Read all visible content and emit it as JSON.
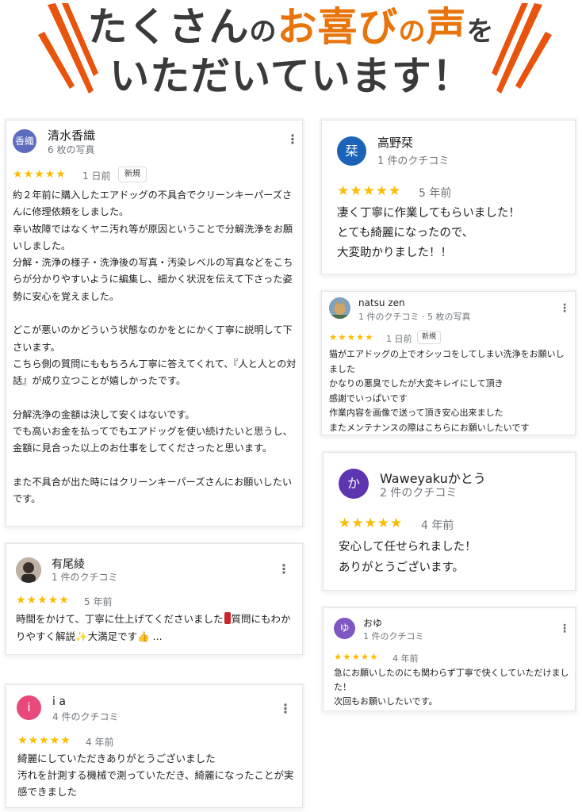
{
  "header": {
    "line1_parts": [
      "たくさん",
      "の",
      "お喜び",
      "の",
      "声",
      "を"
    ],
    "line2": "いただいています！"
  },
  "reviews": [
    {
      "name": "清水香織",
      "avatar_text": "香織",
      "avatar_color": "#5c6bc0",
      "meta": "6 枚の写真",
      "stars": "★★★★★",
      "time": "1 日前",
      "badge": "新規",
      "body": "約２年前に購入したエアドッグの不具合でクリーンキーパーズさんに修理依頼をしました。\n幸い故障ではなくヤニ汚れ等が原因ということで分解洗浄をお願いしました。\n分解・洗浄の様子・洗浄後の写真・汚染レベルの写真などをこちらが分かりやすいように編集し、細かく状況を伝えて下さった姿勢に安心を覚えました。\n\nどこが悪いのかどういう状態なのかをとにかく丁寧に説明して下さいます。\nこちら側の質問にももちろん丁寧に答えてくれて、『人と人との対話』が成り立つことが嬉しかったです。\n\n分解洗浄の金額は決して安くはないです。\nでも高いお金を払ってでもエアドッグを使い続けたいと思うし、金額に見合った以上のお仕事をしてくださったと思います。\n\nまた不具合が出た時にはクリーンキーパーズさんにお願いしたいです。"
    },
    {
      "name": "有尾綾",
      "avatar_text": "",
      "avatar_color": "#8d7b6a",
      "meta": "1 件のクチコミ",
      "stars": "★★★★★",
      "time": "5 年前",
      "body_parts": [
        "時間をかけて、丁寧に仕上げてくださいました",
        "質問にもわかりやすく解説",
        "大満足です",
        " ..."
      ]
    },
    {
      "name": "i a",
      "avatar_text": "i",
      "avatar_color": "#e8497a",
      "meta": "4 件のクチコミ",
      "stars": "★★★★★",
      "time": "4 年前",
      "body": "綺麗にしていただきありがとうございました\n汚れを計測する機械で測っていただき、綺麗になったことが実感できました"
    },
    {
      "name": "高野栞",
      "avatar_text": "栞",
      "avatar_color": "#1a63b8",
      "meta": "1 件のクチコミ",
      "stars": "★★★★★",
      "time": "5 年前",
      "body": "凄く丁寧に作業してもらいました！\nとても綺麗になったので、\n大変助かりました！！"
    },
    {
      "name": "natsu zen",
      "avatar_text": "",
      "avatar_color": "#6e8fa8",
      "meta": "1 件のクチコミ · 5 枚の写真",
      "stars": "★★★★★",
      "time": "1 日前",
      "badge": "新規",
      "body": "猫がエアドッグの上でオシッコをしてしまい洗浄をお願いしました\nかなりの悪臭でしたが大変キレイにして頂き\n感謝でいっぱいです\n作業内容を画像で送って頂き安心出来ました\nまたメンテナンスの際はこちらにお願いしたいです"
    },
    {
      "name": "Waweyakuかとう",
      "avatar_text": "か",
      "avatar_color": "#5e35b1",
      "meta": "2 件のクチコミ",
      "stars": "★★★★★",
      "time": "4 年前",
      "body": "安心して任せられました！\nありがとうございます。"
    },
    {
      "name": "おゆ",
      "avatar_text": "ゆ",
      "avatar_color": "#7e57c2",
      "meta": "1 件のクチコミ",
      "stars": "★★★★★",
      "time": "4 年前",
      "body": "急にお願いしたのにも関わらず丁寧で快くしていただけました！\n次回もお願いしたいです。"
    }
  ],
  "colors": {
    "accent": "#e8740c",
    "star": "#fbbc04",
    "burst": "#e8540c"
  }
}
